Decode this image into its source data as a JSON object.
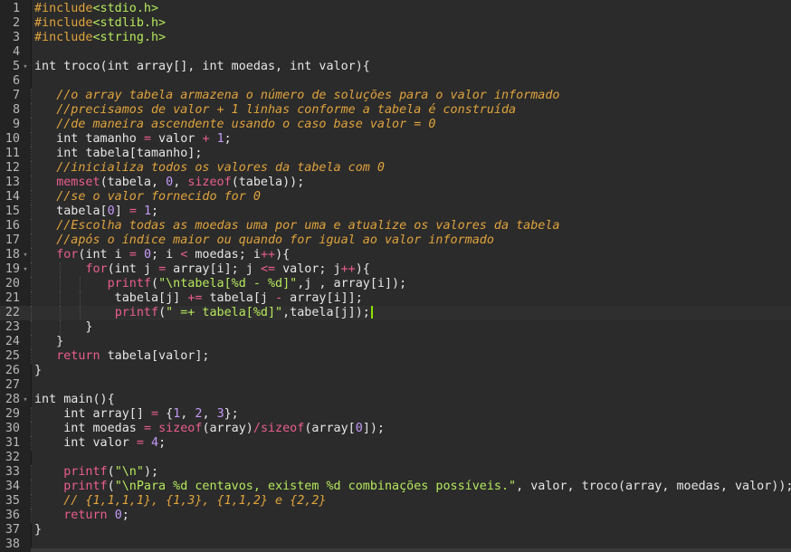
{
  "colors": {
    "background": "#2b2b2b",
    "gutter": "#232323",
    "text": "#e6e6e6",
    "keyword": "#e6e6e6",
    "comment": "#e0a33c",
    "string": "#b6e85c",
    "number": "#c49bf7",
    "operator": "#ea5e8c",
    "function": "#ea5e8c",
    "preprocessor": "#e0a33c",
    "cursor": "#8ee000"
  },
  "editor": {
    "language": "C",
    "cursor_line": 22,
    "lines": [
      {
        "n": "1",
        "fold": "",
        "indent": 0,
        "tokens": [
          {
            "t": "pp",
            "v": "#include"
          },
          {
            "t": "str",
            "v": "<stdio.h>"
          }
        ]
      },
      {
        "n": "2",
        "fold": "",
        "indent": 0,
        "tokens": [
          {
            "t": "pp",
            "v": "#include"
          },
          {
            "t": "str",
            "v": "<stdlib.h>"
          }
        ]
      },
      {
        "n": "3",
        "fold": "",
        "indent": 0,
        "tokens": [
          {
            "t": "pp",
            "v": "#include"
          },
          {
            "t": "str",
            "v": "<string.h>"
          }
        ]
      },
      {
        "n": "4",
        "fold": "",
        "indent": 0,
        "tokens": []
      },
      {
        "n": "5",
        "fold": "▾",
        "indent": 0,
        "tokens": [
          {
            "t": "n",
            "v": "int troco(int array[], int moedas, int valor){"
          }
        ]
      },
      {
        "n": "6",
        "fold": "",
        "indent": 0,
        "tokens": []
      },
      {
        "n": "7",
        "fold": "",
        "indent": 1,
        "tokens": [
          {
            "t": "n",
            "v": "   "
          },
          {
            "t": "c",
            "v": "//o array tabela armazena o número de soluções para o valor informado"
          }
        ]
      },
      {
        "n": "8",
        "fold": "",
        "indent": 1,
        "tokens": [
          {
            "t": "n",
            "v": "   "
          },
          {
            "t": "c",
            "v": "//precisamos de valor + 1 linhas conforme a tabela é construída"
          }
        ]
      },
      {
        "n": "9",
        "fold": "",
        "indent": 1,
        "tokens": [
          {
            "t": "n",
            "v": "   "
          },
          {
            "t": "c",
            "v": "//de maneira ascendente usando o caso base valor = 0"
          }
        ]
      },
      {
        "n": "10",
        "fold": "",
        "indent": 1,
        "tokens": [
          {
            "t": "n",
            "v": "   int tamanho "
          },
          {
            "t": "op",
            "v": "="
          },
          {
            "t": "n",
            "v": " valor "
          },
          {
            "t": "op",
            "v": "+"
          },
          {
            "t": "n",
            "v": " "
          },
          {
            "t": "num",
            "v": "1"
          },
          {
            "t": "n",
            "v": ";"
          }
        ]
      },
      {
        "n": "11",
        "fold": "",
        "indent": 1,
        "tokens": [
          {
            "t": "n",
            "v": "   int tabela[tamanho];"
          }
        ]
      },
      {
        "n": "12",
        "fold": "",
        "indent": 1,
        "tokens": [
          {
            "t": "n",
            "v": "   "
          },
          {
            "t": "c",
            "v": "//inicializa todos os valores da tabela com 0"
          }
        ]
      },
      {
        "n": "13",
        "fold": "",
        "indent": 1,
        "tokens": [
          {
            "t": "n",
            "v": "   "
          },
          {
            "t": "fn",
            "v": "memset"
          },
          {
            "t": "n",
            "v": "(tabela, "
          },
          {
            "t": "num",
            "v": "0"
          },
          {
            "t": "n",
            "v": ", "
          },
          {
            "t": "fn",
            "v": "sizeof"
          },
          {
            "t": "n",
            "v": "(tabela));"
          }
        ]
      },
      {
        "n": "14",
        "fold": "",
        "indent": 1,
        "tokens": [
          {
            "t": "n",
            "v": "   "
          },
          {
            "t": "c",
            "v": "//se o valor fornecido for 0"
          }
        ]
      },
      {
        "n": "15",
        "fold": "",
        "indent": 1,
        "tokens": [
          {
            "t": "n",
            "v": "   tabela["
          },
          {
            "t": "num",
            "v": "0"
          },
          {
            "t": "n",
            "v": "] "
          },
          {
            "t": "op",
            "v": "="
          },
          {
            "t": "n",
            "v": " "
          },
          {
            "t": "num",
            "v": "1"
          },
          {
            "t": "n",
            "v": ";"
          }
        ]
      },
      {
        "n": "16",
        "fold": "",
        "indent": 1,
        "tokens": [
          {
            "t": "n",
            "v": "   "
          },
          {
            "t": "c",
            "v": "//Escolha todas as moedas uma por uma e atualize os valores da tabela"
          }
        ]
      },
      {
        "n": "17",
        "fold": "",
        "indent": 1,
        "tokens": [
          {
            "t": "n",
            "v": "   "
          },
          {
            "t": "c",
            "v": "//após o índice maior ou quando for igual ao valor informado"
          }
        ]
      },
      {
        "n": "18",
        "fold": "▾",
        "indent": 1,
        "tokens": [
          {
            "t": "n",
            "v": "   "
          },
          {
            "t": "fn",
            "v": "for"
          },
          {
            "t": "n",
            "v": "(int i "
          },
          {
            "t": "op",
            "v": "="
          },
          {
            "t": "n",
            "v": " "
          },
          {
            "t": "num",
            "v": "0"
          },
          {
            "t": "n",
            "v": "; i "
          },
          {
            "t": "op",
            "v": "<"
          },
          {
            "t": "n",
            "v": " moedas; i"
          },
          {
            "t": "op",
            "v": "++"
          },
          {
            "t": "n",
            "v": "){"
          }
        ]
      },
      {
        "n": "19",
        "fold": "▾",
        "indent": 2,
        "tokens": [
          {
            "t": "n",
            "v": "       "
          },
          {
            "t": "fn",
            "v": "for"
          },
          {
            "t": "n",
            "v": "(int j "
          },
          {
            "t": "op",
            "v": "="
          },
          {
            "t": "n",
            "v": " array[i]; j "
          },
          {
            "t": "op",
            "v": "<="
          },
          {
            "t": "n",
            "v": " valor; j"
          },
          {
            "t": "op",
            "v": "++"
          },
          {
            "t": "n",
            "v": "){"
          }
        ]
      },
      {
        "n": "20",
        "fold": "",
        "indent": 3,
        "tokens": [
          {
            "t": "n",
            "v": "          "
          },
          {
            "t": "fn",
            "v": "printf"
          },
          {
            "t": "n",
            "v": "("
          },
          {
            "t": "str",
            "v": "\"\\ntabela[%d - %d]\""
          },
          {
            "t": "n",
            "v": ",j , array[i]);"
          }
        ]
      },
      {
        "n": "21",
        "fold": "",
        "indent": 3,
        "tokens": [
          {
            "t": "n",
            "v": "           tabela[j] "
          },
          {
            "t": "op",
            "v": "+="
          },
          {
            "t": "n",
            "v": " tabela[j "
          },
          {
            "t": "op",
            "v": "-"
          },
          {
            "t": "n",
            "v": " array[i]];"
          }
        ]
      },
      {
        "n": "22",
        "fold": "",
        "indent": 3,
        "tokens": [
          {
            "t": "n",
            "v": "           "
          },
          {
            "t": "fn",
            "v": "printf"
          },
          {
            "t": "n",
            "v": "("
          },
          {
            "t": "str",
            "v": "\" =+ tabela[%d]\""
          },
          {
            "t": "n",
            "v": ",tabela[j]);"
          }
        ]
      },
      {
        "n": "23",
        "fold": "",
        "indent": 2,
        "tokens": [
          {
            "t": "n",
            "v": "       }"
          }
        ]
      },
      {
        "n": "24",
        "fold": "",
        "indent": 1,
        "tokens": [
          {
            "t": "n",
            "v": "   }"
          }
        ]
      },
      {
        "n": "25",
        "fold": "",
        "indent": 1,
        "tokens": [
          {
            "t": "n",
            "v": "   "
          },
          {
            "t": "fn",
            "v": "return"
          },
          {
            "t": "n",
            "v": " tabela[valor];"
          }
        ]
      },
      {
        "n": "26",
        "fold": "",
        "indent": 0,
        "tokens": [
          {
            "t": "n",
            "v": "}"
          }
        ]
      },
      {
        "n": "27",
        "fold": "",
        "indent": 0,
        "tokens": []
      },
      {
        "n": "28",
        "fold": "▾",
        "indent": 0,
        "tokens": [
          {
            "t": "n",
            "v": "int main(){"
          }
        ]
      },
      {
        "n": "29",
        "fold": "",
        "indent": 1,
        "tokens": [
          {
            "t": "n",
            "v": "    int array[] "
          },
          {
            "t": "op",
            "v": "="
          },
          {
            "t": "n",
            "v": " {"
          },
          {
            "t": "num",
            "v": "1"
          },
          {
            "t": "n",
            "v": ", "
          },
          {
            "t": "num",
            "v": "2"
          },
          {
            "t": "n",
            "v": ", "
          },
          {
            "t": "num",
            "v": "3"
          },
          {
            "t": "n",
            "v": "};"
          }
        ]
      },
      {
        "n": "30",
        "fold": "",
        "indent": 1,
        "tokens": [
          {
            "t": "n",
            "v": "    int moedas "
          },
          {
            "t": "op",
            "v": "="
          },
          {
            "t": "n",
            "v": " "
          },
          {
            "t": "fn",
            "v": "sizeof"
          },
          {
            "t": "n",
            "v": "(array)"
          },
          {
            "t": "op",
            "v": "/"
          },
          {
            "t": "fn",
            "v": "sizeof"
          },
          {
            "t": "n",
            "v": "(array["
          },
          {
            "t": "num",
            "v": "0"
          },
          {
            "t": "n",
            "v": "]);"
          }
        ]
      },
      {
        "n": "31",
        "fold": "",
        "indent": 1,
        "tokens": [
          {
            "t": "n",
            "v": "    int valor "
          },
          {
            "t": "op",
            "v": "="
          },
          {
            "t": "n",
            "v": " "
          },
          {
            "t": "num",
            "v": "4"
          },
          {
            "t": "n",
            "v": ";"
          }
        ]
      },
      {
        "n": "32",
        "fold": "",
        "indent": 0,
        "tokens": []
      },
      {
        "n": "33",
        "fold": "",
        "indent": 1,
        "tokens": [
          {
            "t": "n",
            "v": "    "
          },
          {
            "t": "fn",
            "v": "printf"
          },
          {
            "t": "n",
            "v": "("
          },
          {
            "t": "str",
            "v": "\"\\n\""
          },
          {
            "t": "n",
            "v": ");"
          }
        ]
      },
      {
        "n": "34",
        "fold": "",
        "indent": 1,
        "tokens": [
          {
            "t": "n",
            "v": "    "
          },
          {
            "t": "fn",
            "v": "printf"
          },
          {
            "t": "n",
            "v": "("
          },
          {
            "t": "str",
            "v": "\"\\nPara %d centavos, existem %d combinações possíveis.\""
          },
          {
            "t": "n",
            "v": ", valor, troco(array, moedas, valor));"
          }
        ]
      },
      {
        "n": "35",
        "fold": "",
        "indent": 1,
        "tokens": [
          {
            "t": "n",
            "v": "    "
          },
          {
            "t": "c",
            "v": "// {1,1,1,1}, {1,3}, {1,1,2} e {2,2}"
          }
        ]
      },
      {
        "n": "36",
        "fold": "",
        "indent": 1,
        "tokens": [
          {
            "t": "n",
            "v": "    "
          },
          {
            "t": "fn",
            "v": "return"
          },
          {
            "t": "n",
            "v": " "
          },
          {
            "t": "num",
            "v": "0"
          },
          {
            "t": "n",
            "v": ";"
          }
        ]
      },
      {
        "n": "37",
        "fold": "",
        "indent": 0,
        "tokens": [
          {
            "t": "n",
            "v": "}"
          }
        ]
      },
      {
        "n": "38",
        "fold": "",
        "indent": 0,
        "tokens": []
      }
    ]
  }
}
